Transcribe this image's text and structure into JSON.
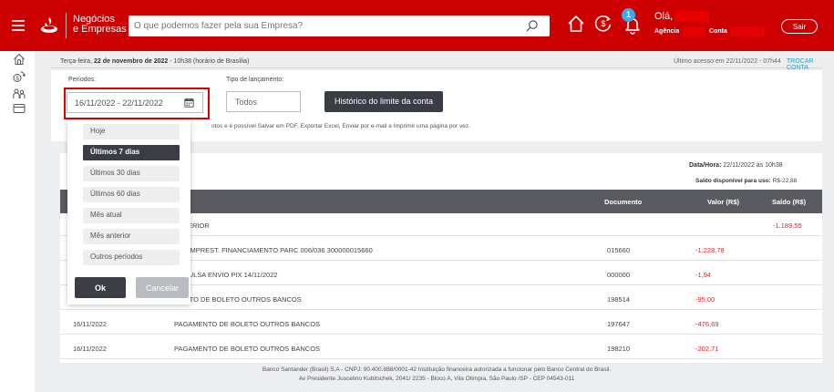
{
  "header": {
    "brand_line1": "Negócios",
    "brand_line2": "e Empresas",
    "search_placeholder": "O que podemos fazer pela sua Empresa?",
    "notification_count": "1",
    "greeting": "Olá,",
    "agency_label": "Agência",
    "account_label": "Conta",
    "exit_label": "Sair",
    "brand_color": "#cc0000"
  },
  "sidebar": {
    "icons": [
      "home-outline-icon",
      "money-exchange-icon",
      "users-icon",
      "card-icon"
    ]
  },
  "info": {
    "weekday": "Terça-feira, ",
    "date": "22 de novembro de 2022",
    "time": " - 10h38 (horário de Brasília)",
    "last_access": "Último acesso em 22/11/2022 - 07h44",
    "switch_account": "TROCAR CONTA"
  },
  "filters": {
    "periods_label": "Períodos:",
    "period_value": "16/11/2022 - 22/11/2022",
    "type_label": "Tipo de lançamento:",
    "type_value": "Todos",
    "history_button": "Histórico do limite da conta",
    "note": "otos e é possível Salvar em PDF, Exportar Excel, Enviar por e-mail e Imprimir uma página por vez."
  },
  "dropdown": {
    "options": [
      "Hoje",
      "Últimos 7 dias",
      "Últimos 30 dias",
      "Últimos 60 dias",
      "Mês atual",
      "Mês anterior",
      "Outros períodos"
    ],
    "selected": "Últimos 7 dias",
    "ok": "Ok",
    "cancel": "Cancelar"
  },
  "statement": {
    "datetime_label": "Data/Hora:",
    "datetime_value": " 22/11/2022 às 10h38",
    "balance_label": "Saldo disponível para uso:",
    "balance_value": " R$-22,88",
    "columns": {
      "description": "co",
      "document": "Documento",
      "value": "Valor (R$)",
      "balance": "Saldo (R$)"
    },
    "rows": [
      {
        "date": "",
        "description": "ANTERIOR",
        "document": "",
        "value": "",
        "balance": "-1.189,55"
      },
      {
        "date": "",
        "description": "DE EMPREST. FINANCIAMENTO PARC 006/036 300000015660",
        "document": "015660",
        "value": "-1.228,78",
        "balance": ""
      },
      {
        "date": "",
        "description": "A AVULSA ENVIO PIX 14/11/2022",
        "document": "000000",
        "value": "-1,94",
        "balance": ""
      },
      {
        "date": "",
        "description": "MENTO DE BOLETO OUTROS BANCOS",
        "document": "198514",
        "value": "-95,00",
        "balance": ""
      },
      {
        "date": "16/11/2022",
        "description": "PAGAMENTO DE BOLETO OUTROS BANCOS",
        "document": "197647",
        "value": "-476,69",
        "balance": ""
      },
      {
        "date": "16/11/2022",
        "description": "PAGAMENTO DE BOLETO OUTROS BANCOS",
        "document": "198210",
        "value": "-202,71",
        "balance": ""
      }
    ]
  },
  "footer": {
    "line1": "Banco Santander (Brasil) S.A - CNPJ: 90.400.888/0001-42 Instituição financeira autorizada a funcionar pelo Banco Central do Brasil.",
    "line2": "Av Presidente Juscelino Kubitschek, 2041/ 2235 - Bloco A, Vila Olímpia, São Paulo /SP - CEP 04543-011"
  }
}
